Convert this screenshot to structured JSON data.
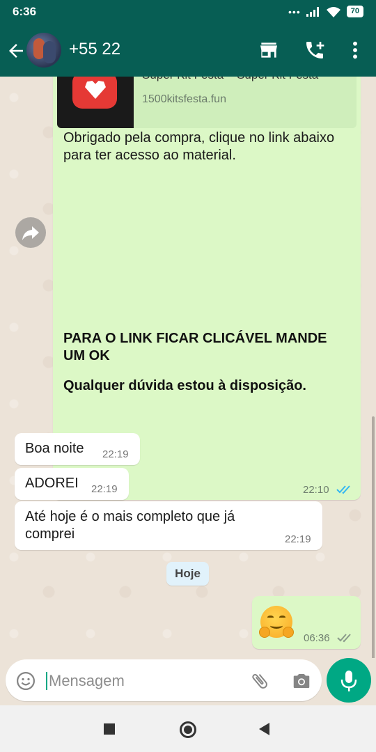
{
  "status_bar": {
    "time": "6:36",
    "battery": "70"
  },
  "header": {
    "contact_name": "+55 22"
  },
  "messages": {
    "outgoing_main": {
      "link_title": "Super Kit Festa – Super Kit Festa",
      "link_domain": "1500kitsfesta.fun",
      "text": "Obrigado pela compra, clique no link abaixo para ter acesso ao material.",
      "bold_line1": " PARA O LINK FICAR CLICÁVEL MANDE UM OK",
      "bold_line2": " Qualquer dúvida estou à disposição.",
      "time": "22:10"
    },
    "incoming": [
      {
        "text": "Boa noite",
        "time": "22:19"
      },
      {
        "text": "ADOREI",
        "time": "22:19"
      },
      {
        "text": "Até hoje é o mais completo que já comprei",
        "time": "22:19"
      }
    ],
    "date_divider": "Hoje",
    "outgoing_emoji": {
      "emoji": "hugging-face",
      "time": "06:36"
    }
  },
  "composer": {
    "placeholder": "Mensagem"
  },
  "colors": {
    "header": "#075e54",
    "outgoing_bubble": "#dcf8c6",
    "accent": "#00a884",
    "read_ticks": "#34b7f1"
  }
}
